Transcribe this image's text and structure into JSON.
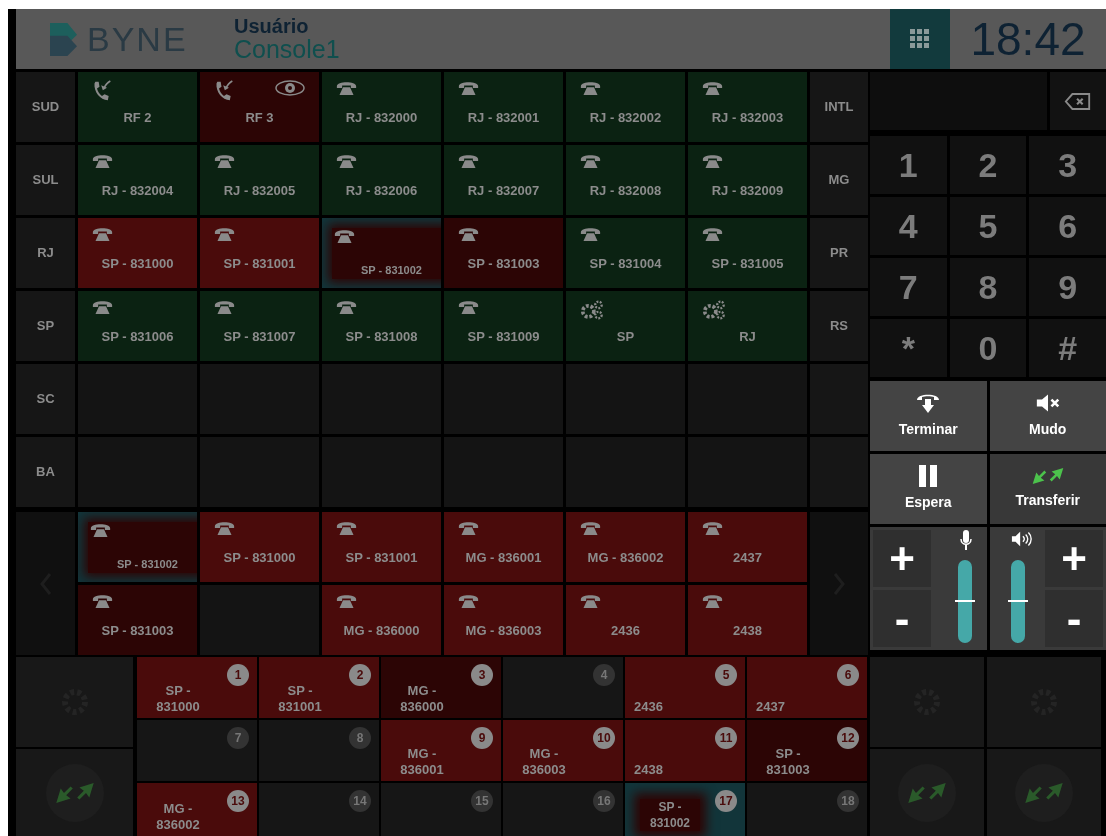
{
  "header": {
    "logo_text": "BYNE",
    "title": "Usuário",
    "subtitle": "Console1",
    "keypad_toggle_selected": true,
    "clock": "18:42"
  },
  "rows": [
    {
      "left": "SUD",
      "right": "INTL",
      "cells": [
        {
          "kind": "radio",
          "label": "RF 2",
          "color": "#0b2212",
          "selected": false,
          "monitored": false
        },
        {
          "kind": "radio",
          "label": "RF 3",
          "color": "#2c0505",
          "selected": false,
          "monitored": true
        },
        {
          "kind": "phone",
          "label": "RJ - 832000",
          "color": "#0b2212",
          "selected": false,
          "monitored": false
        },
        {
          "kind": "phone",
          "label": "RJ - 832001",
          "color": "#0b2212",
          "selected": false,
          "monitored": false
        },
        {
          "kind": "phone",
          "label": "RJ - 832002",
          "color": "#0b2212",
          "selected": false,
          "monitored": false
        },
        {
          "kind": "phone",
          "label": "RJ - 832003",
          "color": "#0b2212",
          "selected": false,
          "monitored": false
        }
      ]
    },
    {
      "left": "SUL",
      "right": "MG",
      "cells": [
        {
          "kind": "phone",
          "label": "RJ - 832004",
          "color": "#0b2212",
          "selected": false,
          "monitored": false
        },
        {
          "kind": "phone",
          "label": "RJ - 832005",
          "color": "#0b2212",
          "selected": false,
          "monitored": false
        },
        {
          "kind": "phone",
          "label": "RJ - 832006",
          "color": "#0b2212",
          "selected": false,
          "monitored": false
        },
        {
          "kind": "phone",
          "label": "RJ - 832007",
          "color": "#0b2212",
          "selected": false,
          "monitored": false
        },
        {
          "kind": "phone",
          "label": "RJ - 832008",
          "color": "#0b2212",
          "selected": false,
          "monitored": false
        },
        {
          "kind": "phone",
          "label": "RJ - 832009",
          "color": "#0b2212",
          "selected": false,
          "monitored": false
        }
      ]
    },
    {
      "left": "RJ",
      "right": "PR",
      "cells": [
        {
          "kind": "phone",
          "label": "SP - 831000",
          "color": "#4a0b0b",
          "selected": false,
          "monitored": false
        },
        {
          "kind": "phone",
          "label": "SP - 831001",
          "color": "#4a0b0b",
          "selected": false,
          "monitored": false
        },
        {
          "kind": "phone",
          "label": "SP - 831002",
          "color": "#2c0505",
          "selected": true,
          "monitored": false
        },
        {
          "kind": "phone",
          "label": "SP - 831003",
          "color": "#2c0505",
          "selected": false,
          "monitored": false
        },
        {
          "kind": "phone",
          "label": "SP - 831004",
          "color": "#0b2212",
          "selected": false,
          "monitored": false
        },
        {
          "kind": "phone",
          "label": "SP - 831005",
          "color": "#0b2212",
          "selected": false,
          "monitored": false
        }
      ]
    },
    {
      "left": "SP",
      "right": "RS",
      "cells": [
        {
          "kind": "phone",
          "label": "SP - 831006",
          "color": "#0b2212",
          "selected": false,
          "monitored": false
        },
        {
          "kind": "phone",
          "label": "SP - 831007",
          "color": "#0b2212",
          "selected": false,
          "monitored": false
        },
        {
          "kind": "phone",
          "label": "SP - 831008",
          "color": "#0b2212",
          "selected": false,
          "monitored": false
        },
        {
          "kind": "phone",
          "label": "SP - 831009",
          "color": "#0b2212",
          "selected": false,
          "monitored": false
        },
        {
          "kind": "group",
          "label": "SP",
          "color": "#0b2212",
          "selected": false,
          "monitored": false
        },
        {
          "kind": "group",
          "label": "RJ",
          "color": "#0b2212",
          "selected": false,
          "monitored": false
        }
      ]
    },
    {
      "left": "SC",
      "cells": [
        {
          "kind": "empty"
        },
        {
          "kind": "empty"
        },
        {
          "kind": "empty"
        },
        {
          "kind": "empty"
        },
        {
          "kind": "empty"
        },
        {
          "kind": "empty"
        }
      ]
    },
    {
      "left": "BA",
      "cells": [
        {
          "kind": "empty"
        },
        {
          "kind": "empty"
        },
        {
          "kind": "empty"
        },
        {
          "kind": "empty"
        },
        {
          "kind": "empty"
        },
        {
          "kind": "empty"
        }
      ]
    }
  ],
  "call_queue": [
    {
      "kind": "phone",
      "label": "SP - 831002",
      "color": "#2c0505",
      "selected": true,
      "monitored": false
    },
    {
      "kind": "phone",
      "label": "SP - 831000",
      "color": "#4a0b0b",
      "selected": false,
      "monitored": false
    },
    {
      "kind": "phone",
      "label": "SP - 831001",
      "color": "#4a0b0b",
      "selected": false,
      "monitored": false
    },
    {
      "kind": "phone",
      "label": "MG - 836001",
      "color": "#4a0b0b",
      "selected": false,
      "monitored": false
    },
    {
      "kind": "phone",
      "label": "MG - 836002",
      "color": "#4a0b0b",
      "selected": false,
      "monitored": false
    },
    {
      "kind": "phone",
      "label": "2437",
      "color": "#4a0b0b",
      "selected": false,
      "monitored": false
    },
    {
      "kind": "phone",
      "label": "SP - 831003",
      "color": "#2c0505",
      "selected": false,
      "monitored": false
    },
    {
      "kind": "empty"
    },
    {
      "kind": "phone",
      "label": "MG - 836000",
      "color": "#4a0b0b",
      "selected": false,
      "monitored": false
    },
    {
      "kind": "phone",
      "label": "MG - 836003",
      "color": "#4a0b0b",
      "selected": false,
      "monitored": false
    },
    {
      "kind": "phone",
      "label": "2436",
      "color": "#4a0b0b",
      "selected": false,
      "monitored": false
    },
    {
      "kind": "phone",
      "label": "2438",
      "color": "#4a0b0b",
      "selected": false,
      "monitored": false
    }
  ],
  "keypad": {
    "keys": [
      "1",
      "2",
      "3",
      "4",
      "5",
      "6",
      "7",
      "8",
      "9",
      "*",
      "0",
      "#"
    ]
  },
  "actions": [
    {
      "kind": "hangup",
      "label": "Terminar"
    },
    {
      "kind": "mute",
      "label": "Mudo"
    },
    {
      "kind": "hold",
      "label": "Espera"
    },
    {
      "kind": "transfer",
      "label": "Transferir"
    }
  ],
  "volume": {
    "mic": {
      "level": 0.5
    },
    "speaker": {
      "level": 0.5
    },
    "plus": "+",
    "minus": "-"
  },
  "parking": [
    {
      "number": "1",
      "label": "SP - 831000",
      "color": "#4a0b0b",
      "selected": false
    },
    {
      "number": "2",
      "label": "SP - 831001",
      "color": "#4a0b0b",
      "selected": false
    },
    {
      "number": "3",
      "label": "MG - 836000",
      "color": "#2c0505",
      "selected": false
    },
    {
      "number": "4",
      "color": "#161616",
      "selected": false
    },
    {
      "number": "5",
      "label": "2436",
      "color": "#4a0b0b",
      "selected": false
    },
    {
      "number": "6",
      "label": "2437",
      "color": "#4a0b0b",
      "selected": false
    },
    {
      "number": "7",
      "color": "#161616",
      "selected": false
    },
    {
      "number": "8",
      "color": "#161616",
      "selected": false
    },
    {
      "number": "9",
      "label": "MG - 836001",
      "color": "#4a0b0b",
      "selected": false
    },
    {
      "number": "10",
      "label": "MG - 836003",
      "color": "#4a0b0b",
      "selected": false
    },
    {
      "number": "11",
      "label": "2438",
      "color": "#4a0b0b",
      "selected": false
    },
    {
      "number": "12",
      "label": "SP - 831003",
      "color": "#2c0505",
      "selected": false
    },
    {
      "number": "13",
      "label": "MG - 836002",
      "color": "#4a0b0b",
      "selected": false
    },
    {
      "number": "14",
      "color": "#161616",
      "selected": false
    },
    {
      "number": "15",
      "color": "#161616",
      "selected": false
    },
    {
      "number": "16",
      "color": "#161616",
      "selected": false
    },
    {
      "number": "17",
      "label": "SP - 831002",
      "color": "#2c0505",
      "selected": true
    },
    {
      "number": "18",
      "color": "#161616",
      "selected": false
    }
  ]
}
